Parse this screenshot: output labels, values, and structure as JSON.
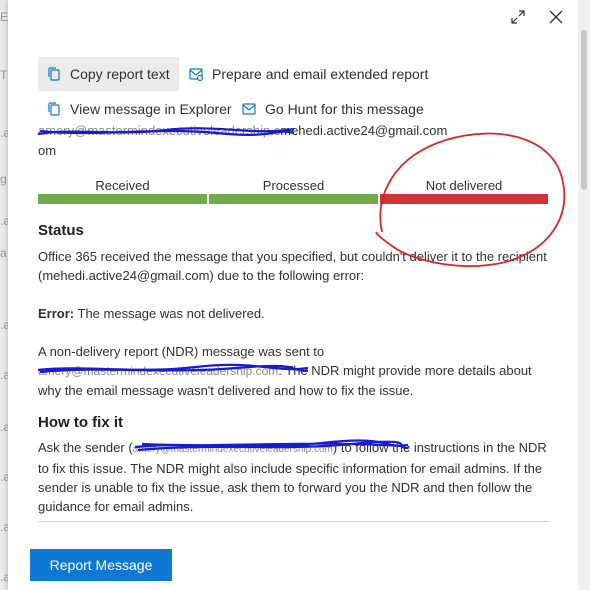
{
  "backdrop_letters": [
    "E",
    "T",
    ".a",
    "g",
    ".a",
    "a",
    ".a",
    ".a",
    ".a",
    ".a",
    ".a",
    ".a"
  ],
  "actions": {
    "copy_report": "Copy report text",
    "prepare_email": "Prepare and email extended report",
    "view_explorer": "View message in Explorer",
    "go_hunt": "Go Hunt for this message"
  },
  "recipient": {
    "redacted_prefix": "amery@mastermindexecutiveleadership.c",
    "visible_email": "mehedi.active24@gmail.com",
    "wrap": "om"
  },
  "progress": {
    "stages": [
      {
        "label": "Received",
        "color": "#70ad47",
        "complete": 1
      },
      {
        "label": "Processed",
        "color": "#70ad47",
        "complete": 1
      },
      {
        "label": "Not delivered",
        "color": "#d13438",
        "complete": 1
      }
    ]
  },
  "status": {
    "heading": "Status",
    "body": "Office 365 received the message that you specified, but couldn't deliver it to the recipient (mehedi.active24@gmail.com) due to the following error:",
    "error_label": "Error:",
    "error_text": " The message was not delivered.",
    "ndr_intro": "A non-delivery report (NDR) message was sent to",
    "ndr_redacted": "amery@mastermindexecutiveleadership.com",
    "ndr_rest": ". The NDR might provide more details about why the email message wasn't delivered and how to fix the issue."
  },
  "fix": {
    "heading": "How to fix it",
    "pre": "Ask the sender (",
    "redacted": "amery@mastermindexecutiveleadership.com",
    "post": ") to follow the instructions in the NDR to fix this issue. The NDR might also include specific information for email admins. If the sender is unable to fix the issue, ask them to forward you the NDR and then follow the guidance for email admins."
  },
  "footer": {
    "report_button": "Report Message"
  },
  "icons": [
    "expand-icon",
    "close-icon",
    "copy-icon",
    "email-report-icon",
    "explorer-icon",
    "hunt-icon"
  ],
  "colors": {
    "accent": "#0f78d4",
    "success": "#70ad47",
    "error": "#d13438",
    "redaction": "#1a1ad0",
    "annotation": "#d42a2a"
  }
}
